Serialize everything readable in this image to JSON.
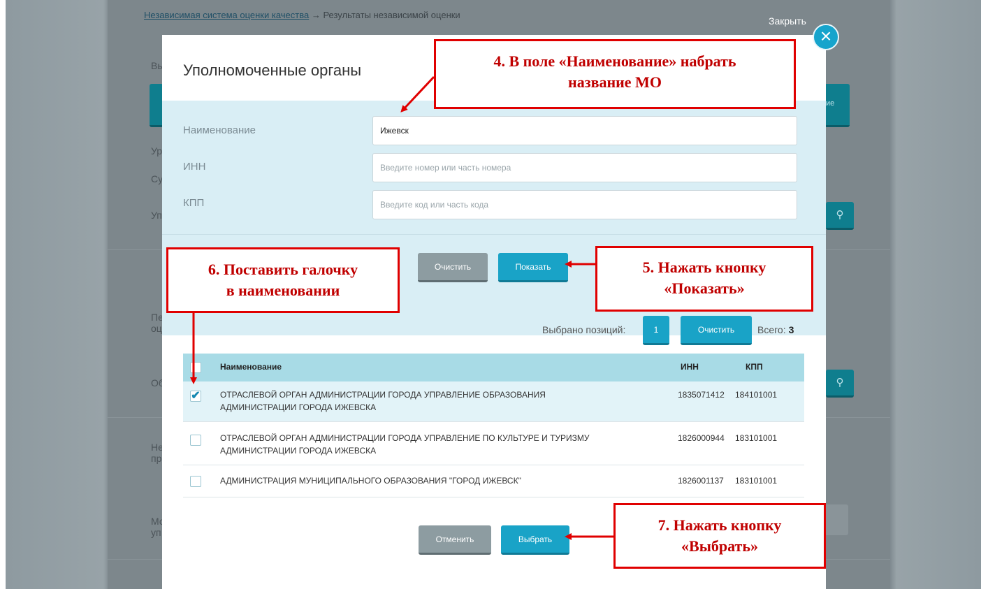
{
  "background": {
    "breadcrumb_link": "Независимая система оценки качества",
    "breadcrumb_rest": " → Результаты независимой оценки",
    "close_label": "Закрыть",
    "side_letters": [
      "Вы",
      "Ур",
      "Су",
      "Уп",
      "Пе",
      "оц",
      "Об",
      "Не",
      "пр",
      "Мо",
      "уп"
    ],
    "side_button_text": "ие"
  },
  "modal": {
    "title": "Уполномоченные органы",
    "filters": {
      "name_label": "Наименование",
      "name_value": "Ижевск",
      "inn_label": "ИНН",
      "inn_placeholder": "Введите номер или часть номера",
      "kpp_label": "КПП",
      "kpp_placeholder": "Введите код или часть кода",
      "clear_button": "Очистить",
      "show_button": "Показать"
    },
    "selection": {
      "selected_label": "Выбрано позиций:",
      "selected_count": "1",
      "clear_button": "Очистить",
      "total_label": "Всего:",
      "total_value": "3"
    },
    "table": {
      "headers": {
        "name": "Наименование",
        "inn": "ИНН",
        "kpp": "КПП"
      },
      "rows": [
        {
          "checked": true,
          "name_line1": "ОТРАСЛЕВОЙ ОРГАН АДМИНИСТРАЦИИ ГОРОДА УПРАВЛЕНИЕ ОБРАЗОВАНИЯ",
          "name_line2": "АДМИНИСТРАЦИИ ГОРОДА ИЖЕВСКА",
          "inn": "1835071412",
          "kpp": "184101001"
        },
        {
          "checked": false,
          "name_line1": "ОТРАСЛЕВОЙ ОРГАН АДМИНИСТРАЦИИ ГОРОДА УПРАВЛЕНИЕ ПО КУЛЬТУРЕ И ТУРИЗМУ",
          "name_line2": "АДМИНИСТРАЦИИ ГОРОДА ИЖЕВСКА",
          "inn": "1826000944",
          "kpp": "183101001"
        },
        {
          "checked": false,
          "name_line1": "АДМИНИСТРАЦИЯ МУНИЦИПАЛЬНОГО ОБРАЗОВАНИЯ \"ГОРОД ИЖЕВСК\"",
          "name_line2": "",
          "inn": "1826001137",
          "kpp": "183101001"
        }
      ]
    },
    "footer": {
      "cancel_button": "Отменить",
      "select_button": "Выбрать"
    }
  },
  "annotations": {
    "step4_line1": "4. В поле «Наименование» набрать",
    "step4_line2": "название МО",
    "step5_line1": "5. Нажать кнопку",
    "step5_line2": "«Показать»",
    "step6_line1": "6. Поставить галочку",
    "step6_line2": "в наименовании",
    "step7_line1": "7. Нажать кнопку",
    "step7_line2": "«Выбрать»"
  },
  "colors": {
    "accent": "#19a3c7",
    "annotation_red": "#e00000",
    "panel": "#d9eef5"
  },
  "icons": {
    "close": "close-icon",
    "search": "search-icon",
    "check": "checkmark-icon"
  }
}
